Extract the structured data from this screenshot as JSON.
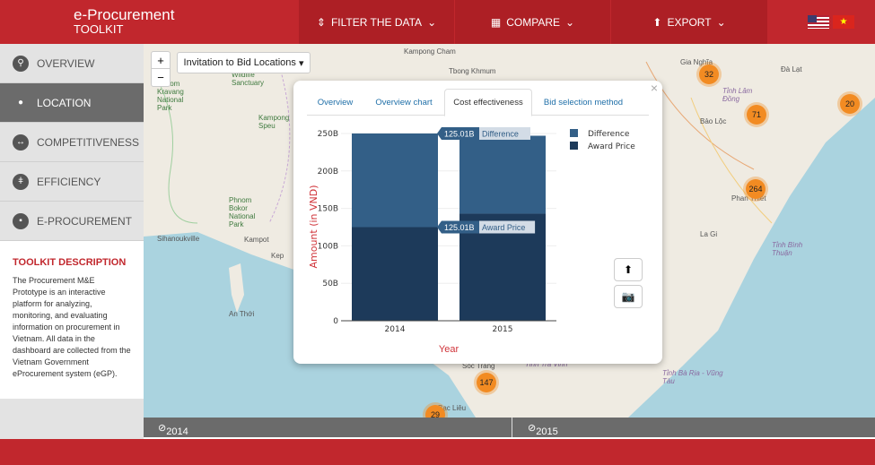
{
  "header": {
    "brand_title": "e-Procurement",
    "brand_subtitle": "TOOLKIT",
    "nav": [
      {
        "label": "FILTER THE DATA",
        "icon": "filter-icon"
      },
      {
        "label": "COMPARE",
        "icon": "grid-icon"
      },
      {
        "label": "EXPORT",
        "icon": "export-icon"
      }
    ],
    "languages": [
      "English",
      "Vietnamese"
    ]
  },
  "sidebar": {
    "items": [
      {
        "label": "OVERVIEW",
        "icon": "search-icon"
      },
      {
        "label": "LOCATION",
        "icon": "map-pin-icon",
        "active": true
      },
      {
        "label": "COMPETITIVENESS",
        "icon": "arrows-icon"
      },
      {
        "label": "EFFICIENCY",
        "icon": "thermometer-icon"
      },
      {
        "label": "E-PROCUREMENT",
        "icon": "chat-icon"
      }
    ],
    "description_title": "TOOLKIT DESCRIPTION",
    "description": "The Procurement M&E Prototype is an interactive platform for analyzing, monitoring, and evaluating information on procurement in Vietnam. All data in the dashboard are collected from the Vietnam Government eProcurement system (eGP)."
  },
  "map": {
    "zoom_in": "+",
    "zoom_out": "−",
    "layer_select": "Invitation to Bid Locations",
    "labels": [
      "Kampong Cham",
      "Tbong Khmum",
      "Gia Nghĩa",
      "Đà Lạt",
      "Tỉnh Lâm Đồng",
      "Bảo Lộc",
      "Phan Thiết",
      "La Gi",
      "Tỉnh Bình Thuận",
      "Kampong Speu",
      "Phnom Kravang National Park",
      "Wildlife Sanctuary",
      "Phnom Bokor National Park",
      "Sihanoukville",
      "Kampot",
      "Kep",
      "An Thới",
      "Tỉnh Trà Vinh",
      "Sóc Trăng",
      "Bạc Liêu",
      "Tỉnh Bà Rịa - Vũng Tàu"
    ],
    "clusters": [
      "32",
      "20",
      "71",
      "264",
      "147",
      "29"
    ]
  },
  "popup": {
    "tabs": [
      "Overview",
      "Overview chart",
      "Cost effectiveness",
      "Bid selection method"
    ],
    "active_tab": "Cost effectiveness",
    "close": "×"
  },
  "chart_data": {
    "type": "bar",
    "stacked": true,
    "categories": [
      "2014",
      "2015"
    ],
    "series": [
      {
        "name": "Award Price",
        "values": [
          125.01,
          143
        ],
        "color": "#1d3a5a"
      },
      {
        "name": "Difference",
        "values": [
          125.01,
          104
        ],
        "color": "#335f87"
      }
    ],
    "xlabel": "Year",
    "ylabel": "Amount (in VND)",
    "ylim": [
      0,
      250
    ],
    "yticks": [
      "0",
      "50B",
      "100B",
      "150B",
      "200B",
      "250B"
    ],
    "tooltips": [
      {
        "value": "125.01B",
        "series": "Difference"
      },
      {
        "value": "125.01B",
        "series": "Award Price"
      }
    ],
    "legend": "top-right",
    "grid": true
  },
  "timeline": {
    "years": [
      "2014",
      "2015"
    ]
  }
}
